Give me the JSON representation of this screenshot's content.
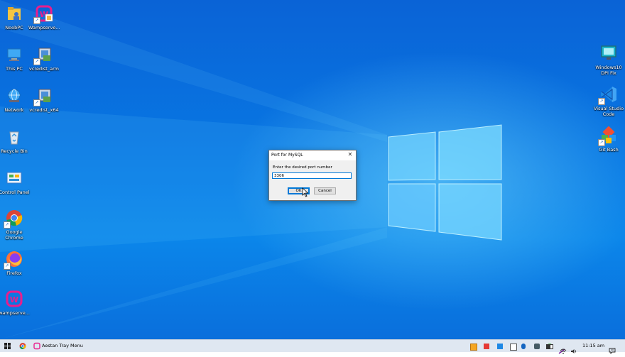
{
  "desktop": {
    "icons_left": [
      {
        "name": "NoobPC",
        "icon": "user-folder-icon"
      },
      {
        "name": "Wampserve...",
        "icon": "wampserver-icon"
      },
      {
        "name": "This PC",
        "icon": "this-pc-icon"
      },
      {
        "name": "vcredist_arm",
        "icon": "installer-icon"
      },
      {
        "name": "Network",
        "icon": "network-icon"
      },
      {
        "name": "vcredist_x64",
        "icon": "installer-icon"
      },
      {
        "name": "Recycle Bin",
        "icon": "recycle-bin-icon"
      },
      {
        "name": "Control Panel",
        "icon": "control-panel-icon"
      },
      {
        "name": "Google\nChrome",
        "icon": "chrome-icon"
      },
      {
        "name": "Firefox",
        "icon": "firefox-icon"
      },
      {
        "name": "wampserve...",
        "icon": "wampserver-icon"
      }
    ],
    "icons_right": [
      {
        "name": "Windows10\nDPI Fix",
        "icon": "monitor-icon"
      },
      {
        "name": "Visual Studio\nCode",
        "icon": "vscode-icon"
      },
      {
        "name": "Git Bash",
        "icon": "git-icon"
      }
    ]
  },
  "dialog": {
    "title": "Port for MySQL",
    "prompt": "Enter the desired port number",
    "value": "3306",
    "ok_label": "OK",
    "cancel_label": "Cancel"
  },
  "taskbar": {
    "tray_menu_label": "Aestan Tray Menu",
    "clock": "11:15 am"
  },
  "colors": {
    "accent": "#0078d7",
    "wamp": "#e91e8c"
  }
}
